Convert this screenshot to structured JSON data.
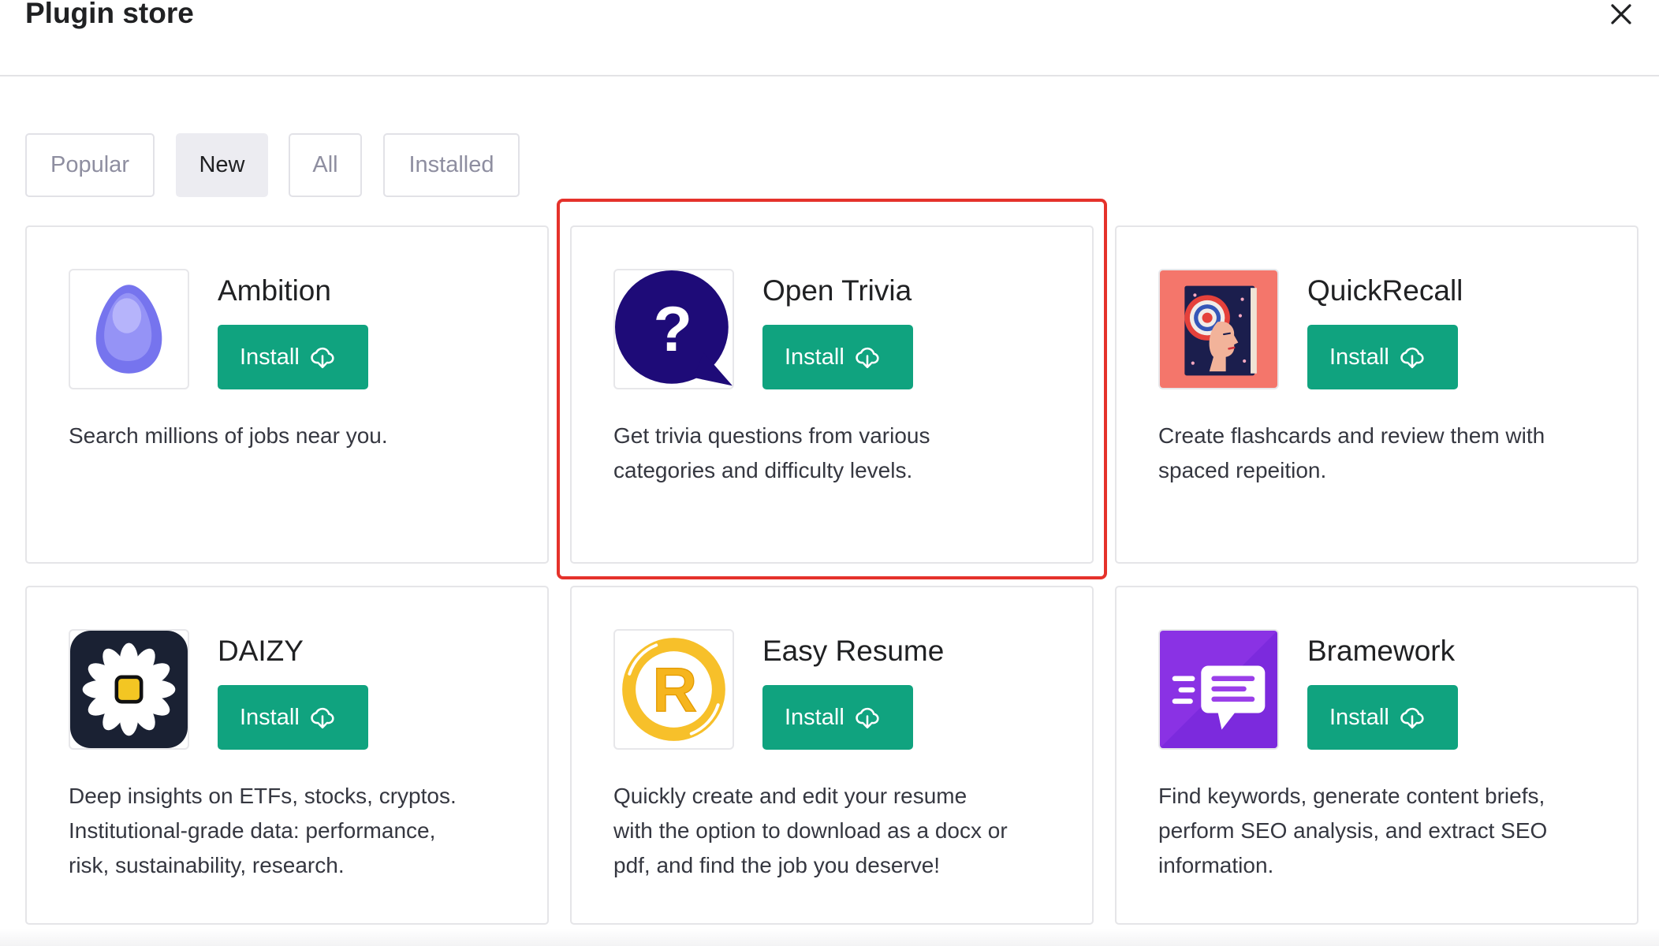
{
  "header": {
    "title": "Plugin store",
    "close_icon": "close-icon"
  },
  "tabs": [
    {
      "label": "Popular",
      "selected": false
    },
    {
      "label": "New",
      "selected": true
    },
    {
      "label": "All",
      "selected": false
    },
    {
      "label": "Installed",
      "selected": false
    }
  ],
  "plugins": [
    {
      "name": "Ambition",
      "icon": "purple-egg-icon",
      "install_label": "Install",
      "description": [
        "Search millions of jobs near you."
      ]
    },
    {
      "name": "Open Trivia",
      "icon": "question-bubble-icon",
      "logo_glyph": "?",
      "install_label": "Install",
      "highlighted": true,
      "description": [
        "Get trivia questions from various",
        "categories and difficulty levels."
      ]
    },
    {
      "name": "QuickRecall",
      "icon": "book-portrait-icon",
      "install_label": "Install",
      "description": [
        "Create flashcards and review them with",
        "spaced repeition."
      ]
    },
    {
      "name": "DAIZY",
      "icon": "daisy-flower-icon",
      "install_label": "Install",
      "description": [
        "Deep insights on ETFs, stocks, cryptos.",
        "Institutional-grade data: performance,",
        "risk, sustainability, research."
      ]
    },
    {
      "name": "Easy Resume",
      "icon": "resume-r-icon",
      "logo_glyph": "R",
      "install_label": "Install",
      "description": [
        "Quickly create and edit your resume",
        "with the option to download as a docx or",
        "pdf, and find the job you deserve!"
      ]
    },
    {
      "name": "Bramework",
      "icon": "chat-bubble-icon",
      "install_label": "Install",
      "description": [
        "Find keywords, generate content briefs,",
        "perform SEO analysis, and extract SEO",
        "information."
      ]
    }
  ],
  "button_icon": "cloud-download-icon",
  "colors": {
    "accent": "#10a37f",
    "highlight": "#e5322b",
    "selected_tab": "#ececf1"
  }
}
